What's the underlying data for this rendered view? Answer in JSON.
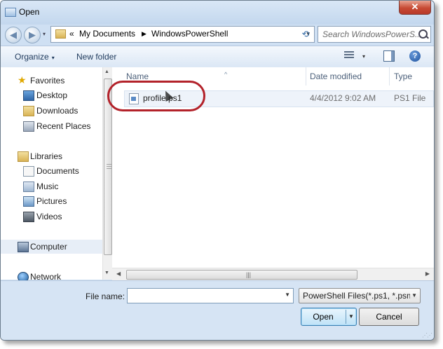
{
  "window": {
    "title": "Open",
    "close_glyph": "✕"
  },
  "address": {
    "back_glyph": "◀",
    "forward_glyph": "▶",
    "recent_glyph": "▾",
    "overflow": "«",
    "segments": [
      "My Documents",
      "WindowsPowerShell"
    ],
    "separator_glyph": "▶",
    "dropdown_glyph": "▾",
    "refresh_glyph": "⟲",
    "search_placeholder": "Search WindowsPowerS..."
  },
  "toolbar": {
    "organize": "Organize",
    "organize_drop": "▾",
    "new_folder": "New folder",
    "view_drop": "▾",
    "help": "?"
  },
  "nav": {
    "favorites": {
      "label": "Favorites",
      "items": [
        "Desktop",
        "Downloads",
        "Recent Places"
      ]
    },
    "libraries": {
      "label": "Libraries",
      "items": [
        "Documents",
        "Music",
        "Pictures",
        "Videos"
      ]
    },
    "computer": "Computer",
    "network": "Network"
  },
  "columns": {
    "name": "Name",
    "date": "Date modified",
    "type": "Type",
    "sort_glyph": "^"
  },
  "files": [
    {
      "name": "profile.ps1",
      "date": "4/4/2012 9:02 AM",
      "type": "PS1 File"
    }
  ],
  "bottom": {
    "file_name_label": "File name:",
    "file_name_value": "",
    "file_type_value": "PowerShell Files(*.ps1, *.psm",
    "open_label": "Open",
    "cancel_label": "Cancel"
  },
  "highlight_color": "#b3222a"
}
